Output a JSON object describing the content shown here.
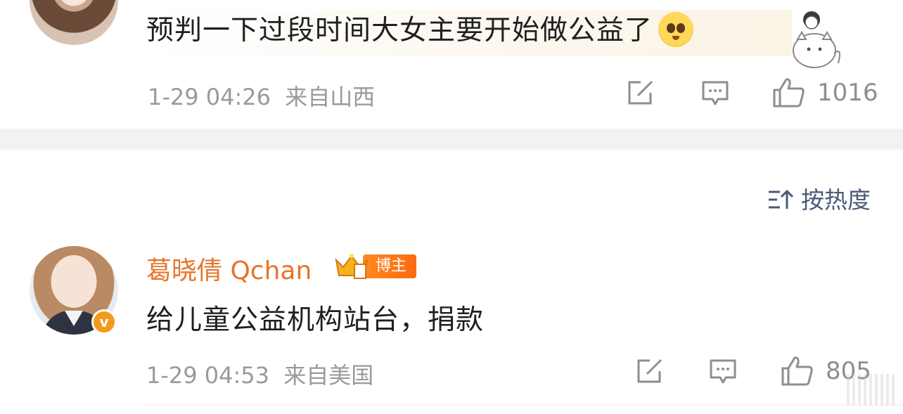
{
  "comment_top": {
    "text": "预判一下过段时间大女主要开始做公益了",
    "emoji_icon": "pleading-face-emoji",
    "sticker_icon": "cat-girl-sticker",
    "date": "1-29 04:26",
    "location": "来自山西",
    "like_count": "1016"
  },
  "sort_label": "按热度",
  "comment_main": {
    "username": "葛晓倩 Qchan",
    "badge_label": "博主",
    "verified_mark": "v",
    "text": "给儿童公益机构站台，捐款",
    "date": "1-29 04:53",
    "location": "来自美国",
    "like_count": "805"
  },
  "colors": {
    "username": "#e8742a",
    "meta": "#9a9a9a",
    "sort": "#4a5a76",
    "separator": "#f2f2f2",
    "badge": "#ff7a18"
  }
}
